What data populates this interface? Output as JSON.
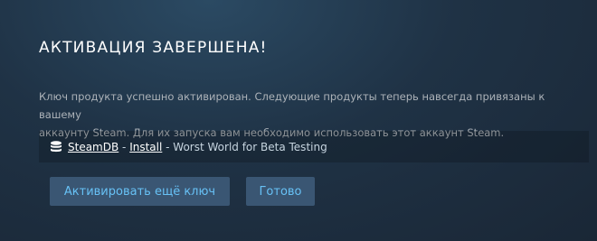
{
  "dialog": {
    "title": "АКТИВАЦИЯ ЗАВЕРШЕНА!",
    "message_line1": "Ключ продукта успешно активирован. Следующие продукты теперь навсегда привязаны к вашему",
    "message_line2": "аккаунту Steam. Для их запуска вам необходимо использовать этот аккаунт Steam.",
    "product": {
      "icon": "steamdb-icon",
      "link1": "SteamDB",
      "separator1": " - ",
      "link2": "Install",
      "separator2": " - ",
      "name": "Worst World for Beta Testing"
    },
    "buttons": {
      "activate_another": "Активировать ещё ключ",
      "done": "Готово"
    }
  },
  "colors": {
    "title": "#ffffff",
    "text": "#acb2b8",
    "button_bg": "#3a5673",
    "button_text": "#67c1f5"
  }
}
